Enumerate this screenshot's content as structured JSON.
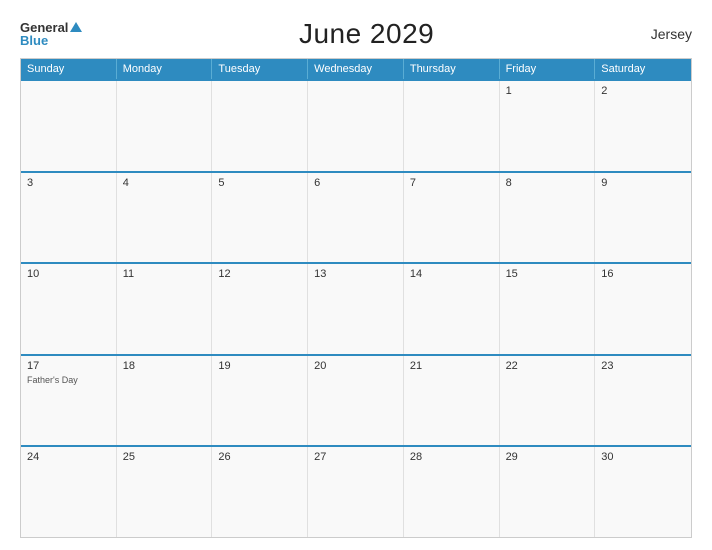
{
  "header": {
    "logo_general": "General",
    "logo_blue": "Blue",
    "title": "June 2029",
    "region": "Jersey"
  },
  "calendar": {
    "days_of_week": [
      "Sunday",
      "Monday",
      "Tuesday",
      "Wednesday",
      "Thursday",
      "Friday",
      "Saturday"
    ],
    "weeks": [
      [
        {
          "day": "",
          "event": ""
        },
        {
          "day": "",
          "event": ""
        },
        {
          "day": "",
          "event": ""
        },
        {
          "day": "",
          "event": ""
        },
        {
          "day": "",
          "event": ""
        },
        {
          "day": "1",
          "event": ""
        },
        {
          "day": "2",
          "event": ""
        }
      ],
      [
        {
          "day": "3",
          "event": ""
        },
        {
          "day": "4",
          "event": ""
        },
        {
          "day": "5",
          "event": ""
        },
        {
          "day": "6",
          "event": ""
        },
        {
          "day": "7",
          "event": ""
        },
        {
          "day": "8",
          "event": ""
        },
        {
          "day": "9",
          "event": ""
        }
      ],
      [
        {
          "day": "10",
          "event": ""
        },
        {
          "day": "11",
          "event": ""
        },
        {
          "day": "12",
          "event": ""
        },
        {
          "day": "13",
          "event": ""
        },
        {
          "day": "14",
          "event": ""
        },
        {
          "day": "15",
          "event": ""
        },
        {
          "day": "16",
          "event": ""
        }
      ],
      [
        {
          "day": "17",
          "event": "Father's Day"
        },
        {
          "day": "18",
          "event": ""
        },
        {
          "day": "19",
          "event": ""
        },
        {
          "day": "20",
          "event": ""
        },
        {
          "day": "21",
          "event": ""
        },
        {
          "day": "22",
          "event": ""
        },
        {
          "day": "23",
          "event": ""
        }
      ],
      [
        {
          "day": "24",
          "event": ""
        },
        {
          "day": "25",
          "event": ""
        },
        {
          "day": "26",
          "event": ""
        },
        {
          "day": "27",
          "event": ""
        },
        {
          "day": "28",
          "event": ""
        },
        {
          "day": "29",
          "event": ""
        },
        {
          "day": "30",
          "event": ""
        }
      ]
    ]
  }
}
